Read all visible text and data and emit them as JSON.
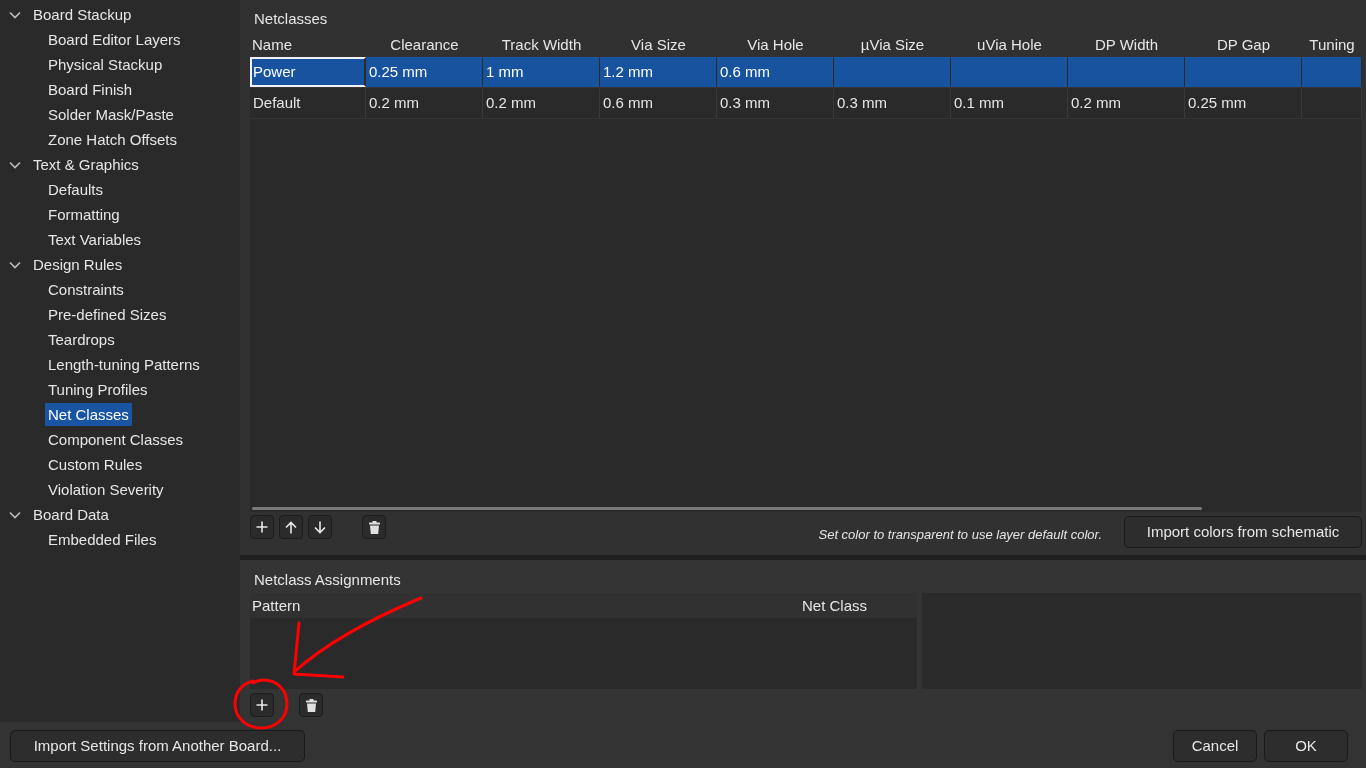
{
  "sidebar": {
    "items": [
      {
        "label": "Board Stackup",
        "expanded": true,
        "selected": false,
        "children": [
          {
            "label": "Board Editor Layers",
            "selected": false
          },
          {
            "label": "Physical Stackup",
            "selected": false
          },
          {
            "label": "Board Finish",
            "selected": false
          },
          {
            "label": "Solder Mask/Paste",
            "selected": false
          },
          {
            "label": "Zone Hatch Offsets",
            "selected": false
          }
        ]
      },
      {
        "label": "Text & Graphics",
        "expanded": true,
        "selected": false,
        "children": [
          {
            "label": "Defaults",
            "selected": false
          },
          {
            "label": "Formatting",
            "selected": false
          },
          {
            "label": "Text Variables",
            "selected": false
          }
        ]
      },
      {
        "label": "Design Rules",
        "expanded": true,
        "selected": false,
        "children": [
          {
            "label": "Constraints",
            "selected": false
          },
          {
            "label": "Pre-defined Sizes",
            "selected": false
          },
          {
            "label": "Teardrops",
            "selected": false
          },
          {
            "label": "Length-tuning Patterns",
            "selected": false
          },
          {
            "label": "Tuning Profiles",
            "selected": false
          },
          {
            "label": "Net Classes",
            "selected": true
          },
          {
            "label": "Component Classes",
            "selected": false
          },
          {
            "label": "Custom Rules",
            "selected": false
          },
          {
            "label": "Violation Severity",
            "selected": false
          }
        ]
      },
      {
        "label": "Board Data",
        "expanded": true,
        "selected": false,
        "children": [
          {
            "label": "Embedded Files",
            "selected": false
          }
        ]
      }
    ]
  },
  "netclasses": {
    "title": "Netclasses",
    "columns": [
      "Name",
      "Clearance",
      "Track Width",
      "Via Size",
      "Via Hole",
      "µVia Size",
      "uVia Hole",
      "DP Width",
      "DP Gap",
      "Tuning"
    ],
    "rows": [
      {
        "cells": [
          "Power",
          "0.25 mm",
          "1 mm",
          "1.2 mm",
          "0.6 mm"
        ],
        "selected": true,
        "current": true
      },
      {
        "cells": [
          "Default",
          "0.2 mm",
          "0.2 mm",
          "0.6 mm",
          "0.3 mm",
          "0.3 mm",
          "0.1 mm",
          "0.2 mm",
          "0.25 mm"
        ],
        "selected": false,
        "current": false
      }
    ],
    "hint": "Set color to transparent to use layer default color.",
    "import_button": "Import colors from schematic"
  },
  "assignments": {
    "title": "Netclass Assignments",
    "columns": [
      "Pattern",
      "Net Class"
    ]
  },
  "footer": {
    "import_button": "Import Settings from Another Board...",
    "buttons": [
      "Cancel",
      "OK"
    ]
  }
}
